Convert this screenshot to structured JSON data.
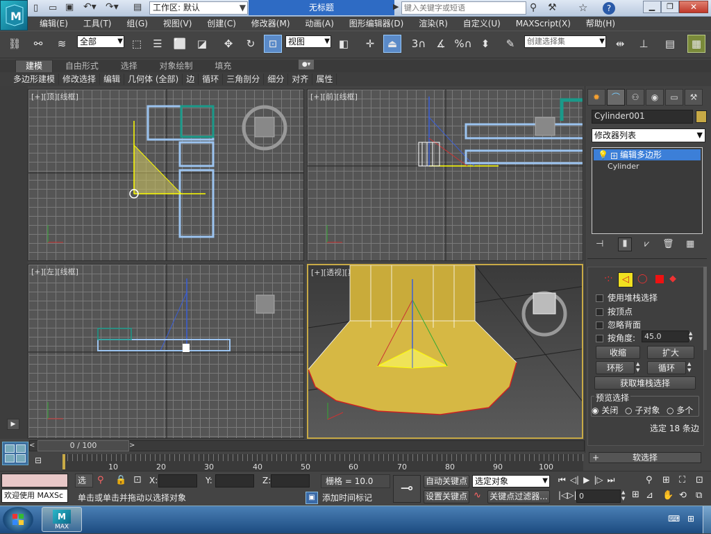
{
  "titlebar": {
    "workspace_label": "工作区: 默认",
    "doc_title": "无标题",
    "search_placeholder": "键入关键字或短语"
  },
  "menus": [
    "编辑(E)",
    "工具(T)",
    "组(G)",
    "视图(V)",
    "创建(C)",
    "修改器(M)",
    "动画(A)",
    "图形编辑器(D)",
    "渲染(R)",
    "自定义(U)",
    "MAXScript(X)",
    "帮助(H)"
  ],
  "toolbar": {
    "filter_value": "全部",
    "ref_coord_value": "视图",
    "named_sel_placeholder": "创建选择集",
    "snap_labels": [
      "3",
      "%"
    ]
  },
  "ribbon": {
    "tabs": [
      "建模",
      "自由形式",
      "选择",
      "对象绘制",
      "填充"
    ],
    "items": [
      "多边形建模",
      "修改选择",
      "编辑",
      "几何体 (全部)",
      "边",
      "循环",
      "三角剖分",
      "细分",
      "对齐",
      "属性"
    ]
  },
  "viewports": {
    "top": "[+][顶][线框]",
    "front": "[+][前][线框]",
    "left": "[+][左][线框]",
    "persp": "[+][透视][真实]"
  },
  "command_panel": {
    "object_name": "Cylinder001",
    "modifier_list": "修改器列表",
    "stack_items": [
      "编辑多边形",
      "Cylinder"
    ],
    "rollout_options": [
      "使用堆栈选择",
      "按顶点",
      "忽略背面"
    ],
    "angle_label": "按角度:",
    "angle_value": "45.0",
    "btn_shrink": "收缩",
    "btn_grow": "扩大",
    "btn_ring": "环形",
    "btn_loop": "循环",
    "btn_get_stack": "获取堆栈选择",
    "preview_group": "预览选择",
    "preview_options": [
      "关闭",
      "子对象",
      "多个"
    ],
    "selected_info": "选定 18 条边",
    "soft_select": "软选择"
  },
  "timeline": {
    "frame_counter": "0 / 100",
    "ticks": [
      "10",
      "20",
      "30",
      "40",
      "50",
      "60",
      "70",
      "80",
      "90",
      "100"
    ]
  },
  "status": {
    "maxscript": "欢迎使用 MAXSc",
    "selected_label": "选择",
    "x_label": "X:",
    "y_label": "Y:",
    "z_label": "Z:",
    "grid_text": "栅格 = 10.0",
    "prompt_text": "单击或单击并拖动以选择对象",
    "add_time_tag": "添加时间标记",
    "auto_key": "自动关键点",
    "set_key": "设置关键点",
    "key_dropdown": "选定对象",
    "key_filters": "关键点过滤器...",
    "frame_field": "0"
  },
  "taskbar": {
    "app_label": "MAX"
  },
  "colors": {
    "accent_blue": "#3c7fd8",
    "selection_yellow": "#ffff00",
    "object_swatch": "#c8aa46"
  }
}
